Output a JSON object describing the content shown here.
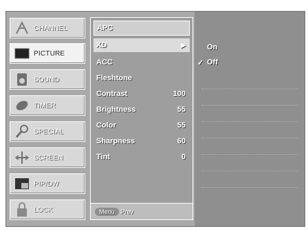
{
  "categories": [
    {
      "label": "CHANNEL",
      "icon": "antenna-icon",
      "selected": false
    },
    {
      "label": "PICTURE",
      "icon": "picture-icon",
      "selected": true
    },
    {
      "label": "SOUND",
      "icon": "sound-icon",
      "selected": false
    },
    {
      "label": "TIMER",
      "icon": "timer-icon",
      "selected": false
    },
    {
      "label": "SPECIAL",
      "icon": "special-icon",
      "selected": false
    },
    {
      "label": "SCREEN",
      "icon": "screen-icon",
      "selected": false
    },
    {
      "label": "PIP/DW",
      "icon": "pip-icon",
      "selected": false
    },
    {
      "label": "LOCK",
      "icon": "lock-icon",
      "selected": false
    }
  ],
  "panel": {
    "title": "APC",
    "rows": [
      {
        "label": "XD",
        "value": "▶",
        "highlight": true
      },
      {
        "label": "ACC",
        "value": ""
      },
      {
        "label": "Fleshtone",
        "value": ""
      },
      {
        "label": "Contrast",
        "value": "100"
      },
      {
        "label": "Brightness",
        "value": "55"
      },
      {
        "label": "Color",
        "value": "55"
      },
      {
        "label": "Sharpness",
        "value": "60"
      },
      {
        "label": "Tint",
        "value": "0"
      }
    ],
    "nav": {
      "menu": "Menu",
      "prev": "Prev"
    }
  },
  "options": [
    {
      "label": "On",
      "checked": false
    },
    {
      "label": "Off",
      "checked": true
    }
  ],
  "colors": {
    "frame": "#a9a9a9",
    "panel": "#9e9e9e",
    "options": "#8f8f8f"
  }
}
